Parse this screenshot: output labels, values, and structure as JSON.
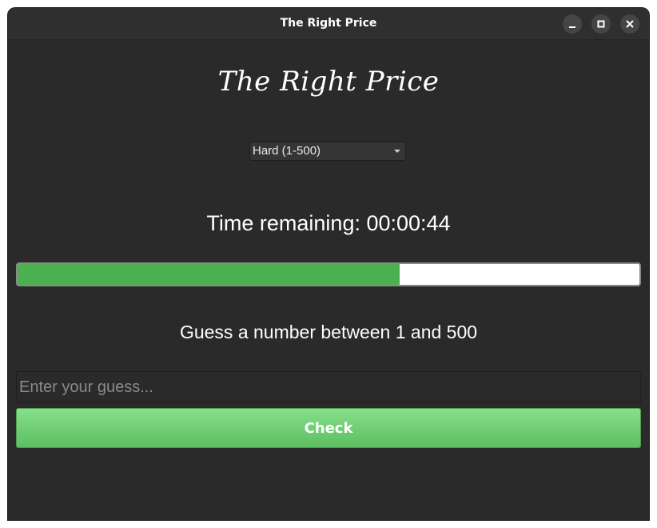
{
  "window": {
    "title": "The Right Price"
  },
  "app": {
    "heading": "The Right Price",
    "difficulty": {
      "selected": "Hard (1-500)"
    },
    "timer_text": "Time remaining: 00:00:44",
    "progress": {
      "fraction": 0.615,
      "fill_color": "#4caf50",
      "track_color": "#ffffff"
    },
    "prompt": "Guess a number between 1 and 500",
    "guess_input": {
      "value": "",
      "placeholder": "Enter your guess..."
    },
    "check_label": "Check",
    "accent_color": "#6fd073"
  },
  "icons": {
    "minimize": "minimize-icon",
    "maximize": "maximize-icon",
    "close": "close-icon",
    "dropdown": "chevron-down-icon"
  }
}
